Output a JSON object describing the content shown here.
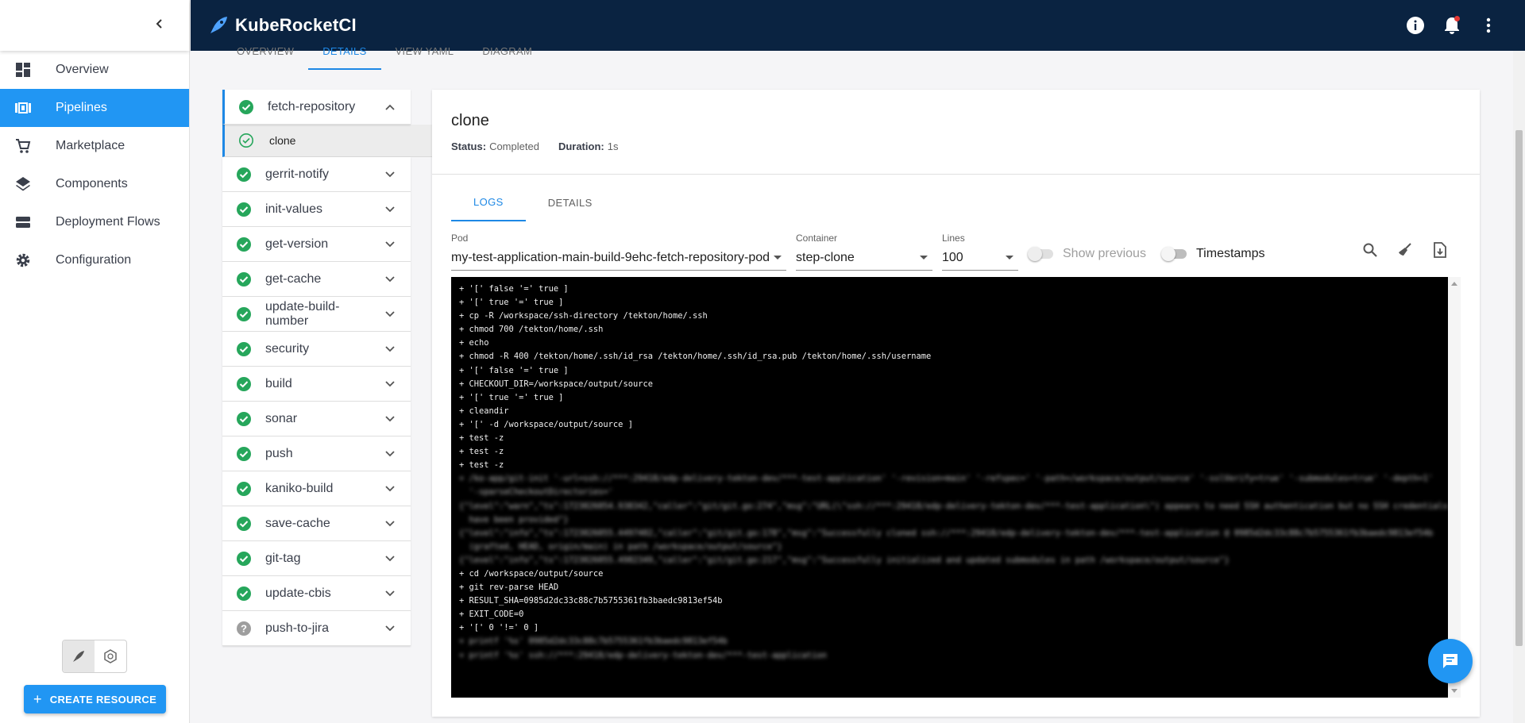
{
  "app": {
    "title": "KubeRocketCI"
  },
  "sidebar": {
    "items": [
      {
        "label": "Overview",
        "icon": "dashboard-icon"
      },
      {
        "label": "Pipelines",
        "icon": "pipelines-icon",
        "active": true
      },
      {
        "label": "Marketplace",
        "icon": "cart-icon"
      },
      {
        "label": "Components",
        "icon": "layers-icon"
      },
      {
        "label": "Deployment Flows",
        "icon": "deployment-icon"
      },
      {
        "label": "Configuration",
        "icon": "gear-icon"
      }
    ],
    "create_label": "CREATE RESOURCE"
  },
  "top_tabs": [
    "OVERVIEW",
    "DETAILS",
    "VIEW YAML",
    "DIAGRAM"
  ],
  "steps": {
    "expanded": {
      "label": "fetch-repository",
      "status": "success"
    },
    "substep": {
      "label": "clone",
      "status": "success"
    },
    "items": [
      {
        "label": "gerrit-notify",
        "status": "success"
      },
      {
        "label": "init-values",
        "status": "success"
      },
      {
        "label": "get-version",
        "status": "success"
      },
      {
        "label": "get-cache",
        "status": "success"
      },
      {
        "label": "update-build-number",
        "status": "success"
      },
      {
        "label": "security",
        "status": "success"
      },
      {
        "label": "build",
        "status": "success"
      },
      {
        "label": "sonar",
        "status": "success"
      },
      {
        "label": "push",
        "status": "success"
      },
      {
        "label": "kaniko-build",
        "status": "success"
      },
      {
        "label": "save-cache",
        "status": "success"
      },
      {
        "label": "git-tag",
        "status": "success"
      },
      {
        "label": "update-cbis",
        "status": "success"
      },
      {
        "label": "push-to-jira",
        "status": "unknown"
      }
    ]
  },
  "detail": {
    "title": "clone",
    "status_label": "Status:",
    "status_value": "Completed",
    "duration_label": "Duration:",
    "duration_value": "1s",
    "tabs": [
      "LOGS",
      "DETAILS"
    ],
    "pod_label": "Pod",
    "pod_value": "my-test-application-main-build-9ehc-fetch-repository-pod",
    "container_label": "Container",
    "container_value": "step-clone",
    "lines_label": "Lines",
    "lines_value": "100",
    "show_previous_label": "Show previous",
    "timestamps_label": "Timestamps"
  },
  "logs": [
    "+ '[' false '=' true ]",
    "+ '[' true '=' true ]",
    "+ cp -R /workspace/ssh-directory /tekton/home/.ssh",
    "+ chmod 700 /tekton/home/.ssh",
    "+ echo",
    "+ chmod -R 400 /tekton/home/.ssh/id_rsa /tekton/home/.ssh/id_rsa.pub /tekton/home/.ssh/username",
    "+ '[' false '=' true ]",
    "+ CHECKOUT_DIR=/workspace/output/source",
    "+ '[' true '=' true ]",
    "+ cleandir",
    "+ '[' -d /workspace/output/source ]",
    "+ test -z",
    "+ test -z",
    "+ test -z"
  ],
  "logs_tail": [
    "+ cd /workspace/output/source",
    "+ git rev-parse HEAD",
    "+ RESULT_SHA=0985d2dc33c88c7b5755361fb3baedc9813ef54b",
    "+ EXIT_CODE=0",
    "+ '[' 0 '!=' 0 ]"
  ]
}
